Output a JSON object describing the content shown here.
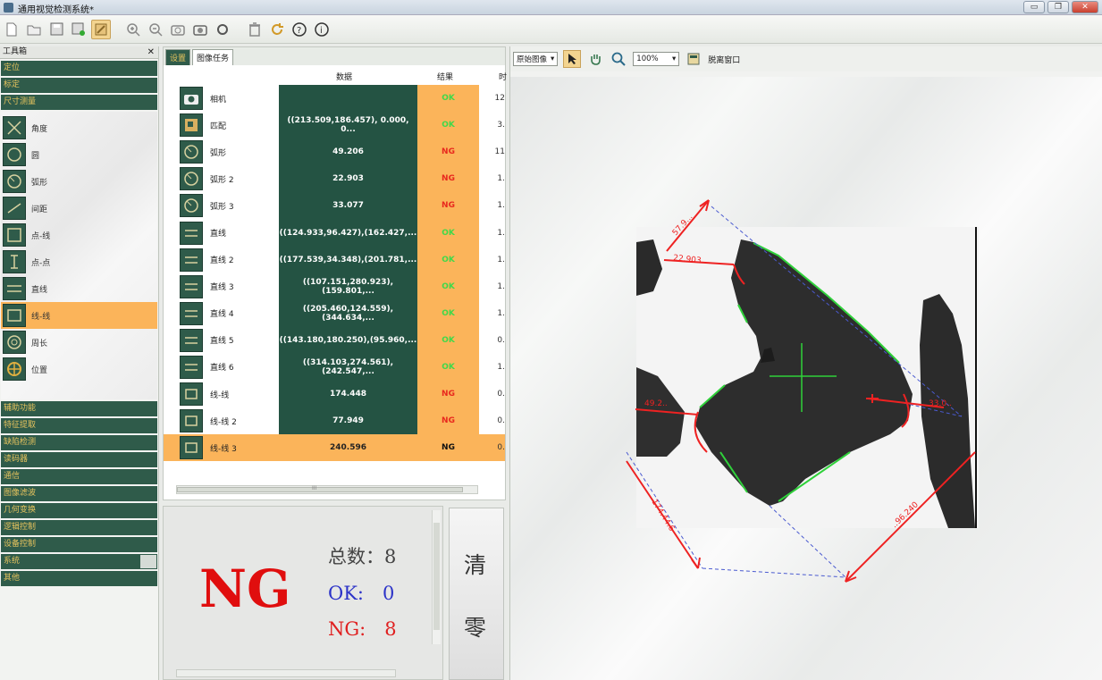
{
  "window": {
    "title": "通用视觉检测系统*",
    "controls": [
      "▭",
      "❐",
      "✕"
    ]
  },
  "toolbar": {
    "icons": [
      "new-file-icon",
      "open-folder-icon",
      "save-icon",
      "save-as-icon",
      "toolbox-icon",
      "zoom-in-icon",
      "zoom-out-icon",
      "camera-icon",
      "camera-shoot-icon",
      "settings-icon",
      "trash-icon",
      "refresh-icon",
      "help-icon",
      "info-icon"
    ]
  },
  "toolbox": {
    "header": "工具箱",
    "close": "✕",
    "categories_top": [
      "定位",
      "标定",
      "尺寸测量"
    ],
    "tools": [
      {
        "label": "角度",
        "icon": "angle-icon"
      },
      {
        "label": "圆",
        "icon": "circle-icon"
      },
      {
        "label": "弧形",
        "icon": "arc-icon"
      },
      {
        "label": "间距",
        "icon": "distance-icon"
      },
      {
        "label": "点-线",
        "icon": "point-line-icon"
      },
      {
        "label": "点-点",
        "icon": "point-point-icon"
      },
      {
        "label": "直线",
        "icon": "line-icon"
      },
      {
        "label": "线-线",
        "icon": "line-line-icon",
        "selected": true
      },
      {
        "label": "周长",
        "icon": "perimeter-icon"
      },
      {
        "label": "位置",
        "icon": "position-icon"
      }
    ],
    "categories_bottom": [
      "辅助功能",
      "特征提取",
      "缺陷检测",
      "读码器",
      "通信",
      "图像滤波",
      "几何变换",
      "逻辑控制",
      "设备控制",
      "系统",
      "其他"
    ]
  },
  "data_panel": {
    "tabs": [
      "设置",
      "图像任务"
    ],
    "columns": {
      "data": "数据",
      "result": "结果",
      "time": "时"
    },
    "rows": [
      {
        "name": "相机",
        "icon": "camera-icon",
        "data": "",
        "result": "OK",
        "time": "12"
      },
      {
        "name": "匹配",
        "icon": "match-icon",
        "data": "((213.509,186.457), 0.000, 0...",
        "result": "OK",
        "time": "3."
      },
      {
        "name": "弧形",
        "icon": "arc-icon",
        "data": "49.206",
        "result": "NG",
        "time": "11"
      },
      {
        "name": "弧形 2",
        "icon": "arc-icon",
        "data": "22.903",
        "result": "NG",
        "time": "1."
      },
      {
        "name": "弧形 3",
        "icon": "arc-icon",
        "data": "33.077",
        "result": "NG",
        "time": "1."
      },
      {
        "name": "直线",
        "icon": "line-icon",
        "data": "((124.933,96.427),(162.427,...",
        "result": "OK",
        "time": "1."
      },
      {
        "name": "直线 2",
        "icon": "line-icon",
        "data": "((177.539,34.348),(201.781,...",
        "result": "OK",
        "time": "1."
      },
      {
        "name": "直线 3",
        "icon": "line-icon",
        "data": "((107.151,280.923),(159.801,...",
        "result": "OK",
        "time": "1."
      },
      {
        "name": "直线 4",
        "icon": "line-icon",
        "data": "((205.460,124.559),(344.634,...",
        "result": "OK",
        "time": "1."
      },
      {
        "name": "直线 5",
        "icon": "line-icon",
        "data": "((143.180,180.250),(95.960,...",
        "result": "OK",
        "time": "0."
      },
      {
        "name": "直线 6",
        "icon": "line-icon",
        "data": "((314.103,274.561),(242.547,...",
        "result": "OK",
        "time": "1."
      },
      {
        "name": "线-线",
        "icon": "line-line-icon",
        "data": "174.448",
        "result": "NG",
        "time": "0."
      },
      {
        "name": "线-线 2",
        "icon": "line-line-icon",
        "data": "77.949",
        "result": "NG",
        "time": "0."
      },
      {
        "name": "线-线 3",
        "icon": "line-line-icon",
        "data": "240.596",
        "result": "NG",
        "time": "0.",
        "selected": true
      }
    ],
    "scroll_mark": "III"
  },
  "stats": {
    "overall": "NG",
    "total": "总数：8",
    "ok": "OK:　0",
    "ng": "NG:　8"
  },
  "clear_button": {
    "top": "清",
    "bottom": "零"
  },
  "image_panel": {
    "select_value": "原始图像",
    "zoom_value": "100%",
    "float_label": "脱离窗口",
    "tools": [
      "pointer-icon",
      "hand-icon",
      "magnifier-icon",
      "float-window-icon"
    ],
    "annotations": {
      "a1": "57.9...",
      "a2": "22.903",
      "a3": "49.2..",
      "a4": "33.0..",
      "a5": "174.44.6",
      "a6": "..96.240"
    }
  },
  "colors": {
    "accent_green": "#2f5b4a",
    "accent_orange": "#fbb45a",
    "ok": "#3fd94a",
    "ng": "#e8281e",
    "label_gold": "#e6c35e"
  }
}
